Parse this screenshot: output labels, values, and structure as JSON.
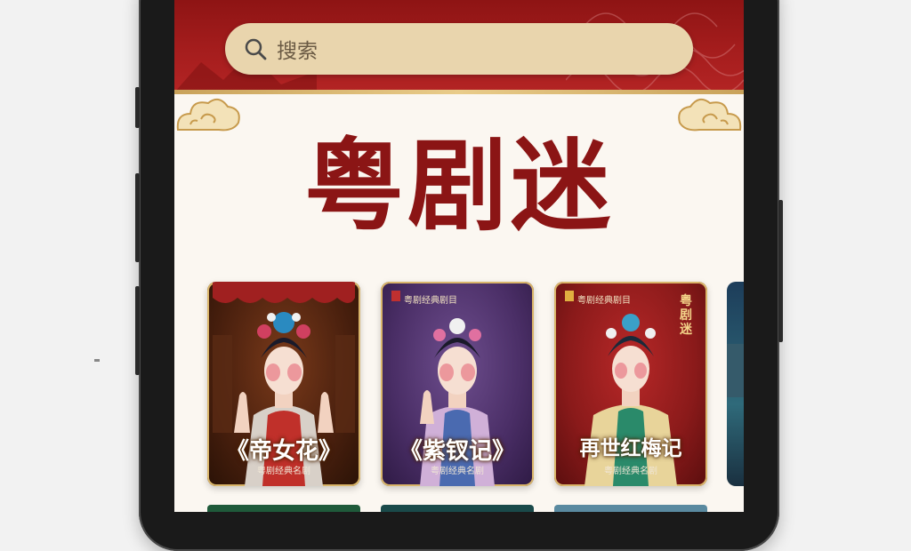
{
  "search": {
    "placeholder": "搜索"
  },
  "app": {
    "title": "粤剧迷"
  },
  "cards": [
    {
      "title": "《帝女花》",
      "subtitle": "粤剧经典名剧",
      "theme": "red-gold"
    },
    {
      "title": "《紫钗记》",
      "subtitle": "粤剧经典名剧",
      "top_text": "粤剧经典剧目",
      "theme": "purple"
    },
    {
      "title": "再世红梅记",
      "subtitle": "粤剧经典名剧",
      "top_text": "粤剧经典剧目",
      "vertical_text": "粤剧迷",
      "theme": "red"
    }
  ],
  "colors": {
    "header_red": "#a51d1d",
    "title_red": "#8b1515",
    "search_bg": "#e9d5ad",
    "gold": "#d9b56a"
  },
  "icons": [
    "search-icon",
    "cloud-ornament-left",
    "cloud-ornament-right"
  ]
}
